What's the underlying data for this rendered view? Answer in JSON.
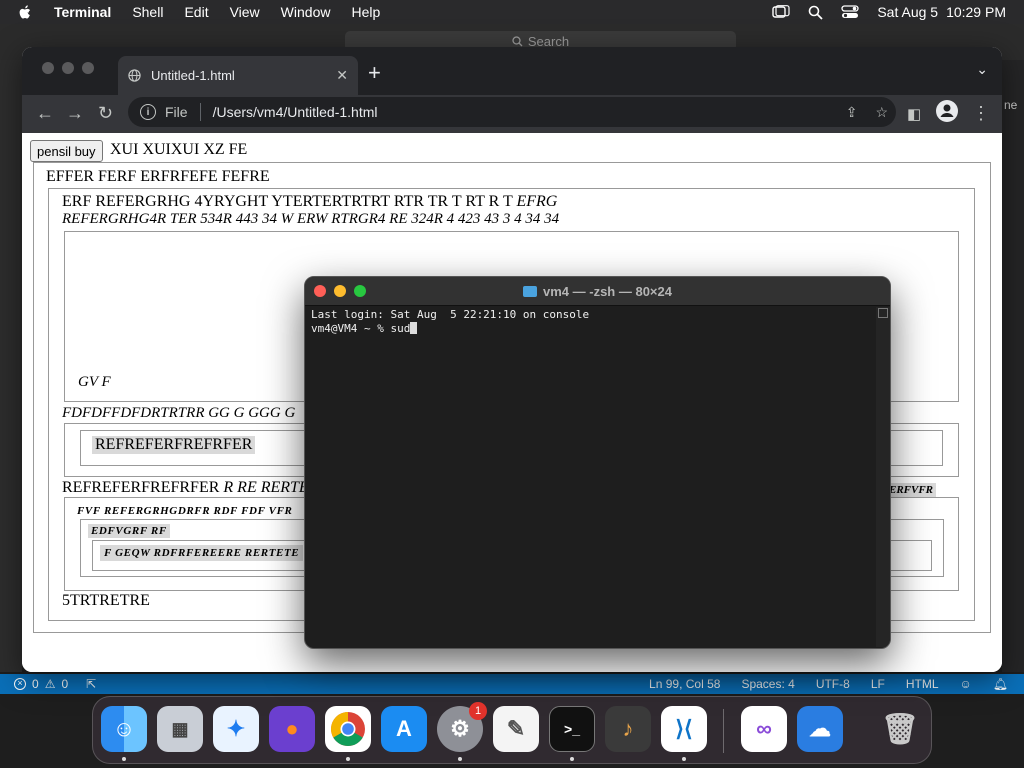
{
  "menubar": {
    "app_name": "Terminal",
    "items": [
      "Shell",
      "Edit",
      "View",
      "Window",
      "Help"
    ],
    "date": "Sat Aug 5",
    "time": "10:29 PM"
  },
  "vscode": {
    "search_placeholder": "Search",
    "right_tab": "ne",
    "status": {
      "problems_errors": "0",
      "problems_warnings": "0",
      "position": "Ln 99, Col 58",
      "spaces": "Spaces: 4",
      "encoding": "UTF-8",
      "eol": "LF",
      "language": "HTML"
    }
  },
  "chrome": {
    "tab_title": "Untitled-1.html",
    "address_scheme": "File",
    "address_path": "/Users/vm4/Untitled-1.html"
  },
  "page": {
    "button_label": "pensil buy",
    "line1": "XUI XUIXUI XZ FE",
    "line2": "EFFER FERF ERFRFEFE FEFRE",
    "line3_normal": "ERF REFERGRHG 4YRYGHT YTERTERTRTRT RTR TR T RT R T",
    "line3_italic": "EFRG",
    "line4_italic": "REFERGRHG4R TER 534R 443 34 W ERW RTRGR4 RE 324R 4 423 43 3 4 34 34",
    "gvf": "GV F",
    "fdf": "FDFDFFDFDRTRTRR GG G GGG G",
    "ref_box": "REFREFERFREFRFER",
    "ref_line_normal": "REFREFERFREFRFER",
    "ref_line_italic": "R RE RERTE",
    "ref_line_right": "ERFVFR",
    "fvf": "FVF REFERGRHGDRFR RDF FDF VFR",
    "edf": "EDFVGRF RF",
    "fgeq": "F GEQW RDFRFEREERE RERTETE",
    "trt": "5TRTRETRE"
  },
  "terminal": {
    "title": "vm4 — -zsh — 80×24",
    "line1": "Last login: Sat Aug  5 22:21:10 on console",
    "prompt": "vm4@VM4 ~ % ",
    "typed": "sud"
  },
  "dock": {
    "apps": [
      "finder-icon",
      "launchpad-icon",
      "safari-icon",
      "firefox-icon",
      "chrome-icon",
      "app-store-icon",
      "system-settings-icon",
      "textedit-icon",
      "terminal-icon",
      "garageband-icon",
      "vscode-icon",
      "visual-studio-icon",
      "weather-icon",
      "trash-icon"
    ],
    "settings_badge": "1",
    "terminal_glyph": ">_"
  }
}
